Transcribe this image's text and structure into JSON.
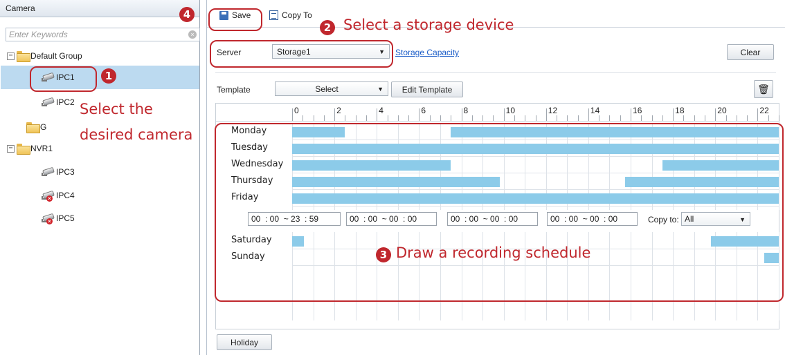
{
  "left": {
    "title": "Camera",
    "search_placeholder": "Enter Keywords",
    "tree": [
      {
        "label": "Default Group",
        "kind": "group",
        "toggle": "−"
      },
      {
        "label": "IPC1",
        "kind": "camera",
        "status": "online",
        "selected": true
      },
      {
        "label": "IPC2",
        "kind": "camera",
        "status": "online"
      },
      {
        "label": "G",
        "kind": "folder"
      },
      {
        "label": "NVR1",
        "kind": "group",
        "toggle": "−"
      },
      {
        "label": "IPC3",
        "kind": "camera",
        "status": "online"
      },
      {
        "label": "IPC4",
        "kind": "camera",
        "status": "offline"
      },
      {
        "label": "IPC5",
        "kind": "camera",
        "status": "offline"
      }
    ]
  },
  "toolbar": {
    "save": "Save",
    "copy_to": "Copy To"
  },
  "server": {
    "label": "Server",
    "value": "Storage1",
    "link": "Storage Capacity",
    "clear": "Clear"
  },
  "template": {
    "label": "Template",
    "value": "Select",
    "edit": "Edit Template"
  },
  "ruler": {
    "labels": [
      "0",
      "2",
      "4",
      "6",
      "8",
      "10",
      "12",
      "14",
      "16",
      "18",
      "20",
      "22"
    ]
  },
  "schedule": {
    "days": [
      {
        "name": "Monday",
        "segments": [
          [
            0,
            5
          ],
          [
            15,
            46
          ]
        ]
      },
      {
        "name": "Tuesday",
        "segments": [
          [
            0,
            46
          ]
        ]
      },
      {
        "name": "Wednesday",
        "segments": [
          [
            0,
            15
          ],
          [
            35,
            46
          ]
        ]
      },
      {
        "name": "Thursday",
        "segments": [
          [
            0,
            19.6
          ],
          [
            31.5,
            46
          ]
        ]
      },
      {
        "name": "Friday",
        "segments": [
          [
            0,
            46
          ]
        ]
      }
    ],
    "time_ranges": [
      "00  : 00  ~ 23  : 59",
      "00  : 00  ~ 00  : 00",
      "00  : 00  ~ 00  : 00",
      "00  : 00  ~ 00  : 00"
    ],
    "copy_to_label": "Copy to:",
    "copy_to_value": "All",
    "weekend": [
      {
        "name": "Saturday",
        "segments": [
          [
            0,
            1.1
          ],
          [
            39.6,
            46
          ]
        ]
      },
      {
        "name": "Sunday",
        "segments": [
          [
            44.6,
            46
          ]
        ]
      }
    ]
  },
  "holiday": "Holiday",
  "annotations": {
    "step1": "1",
    "step2": "2",
    "step3": "3",
    "step4": "4",
    "select_storage": "Select a storage device",
    "select_camera_1": "Select the",
    "select_camera_2": "desired camera",
    "draw_schedule": "Draw a recording schedule"
  },
  "colors": {
    "bar": "#8ccbe9",
    "annotation": "#c0272d",
    "selection": "#bcdaf0"
  }
}
